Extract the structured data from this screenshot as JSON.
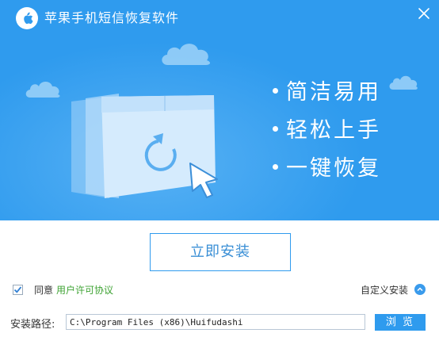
{
  "window": {
    "title": "苹果手机短信恢复软件",
    "close_icon": "close-icon",
    "logo_icon": "apple-logo-icon"
  },
  "banner": {
    "features": [
      "简洁易用",
      "轻松上手",
      "一键恢复"
    ],
    "background_color": "#2f9bee"
  },
  "actions": {
    "install_label": "立即安装"
  },
  "agreement": {
    "checked": true,
    "prefix": "同意",
    "link_label": "用户许可协议",
    "link_color": "#3fa334"
  },
  "custom_install": {
    "label": "自定义安装",
    "icon": "chevron-up-icon"
  },
  "install_path": {
    "label": "安装路径:",
    "value": "C:\\Program Files (x86)\\Huifudashi",
    "browse_label": "浏 览"
  },
  "colors": {
    "accent": "#2f9bee"
  }
}
